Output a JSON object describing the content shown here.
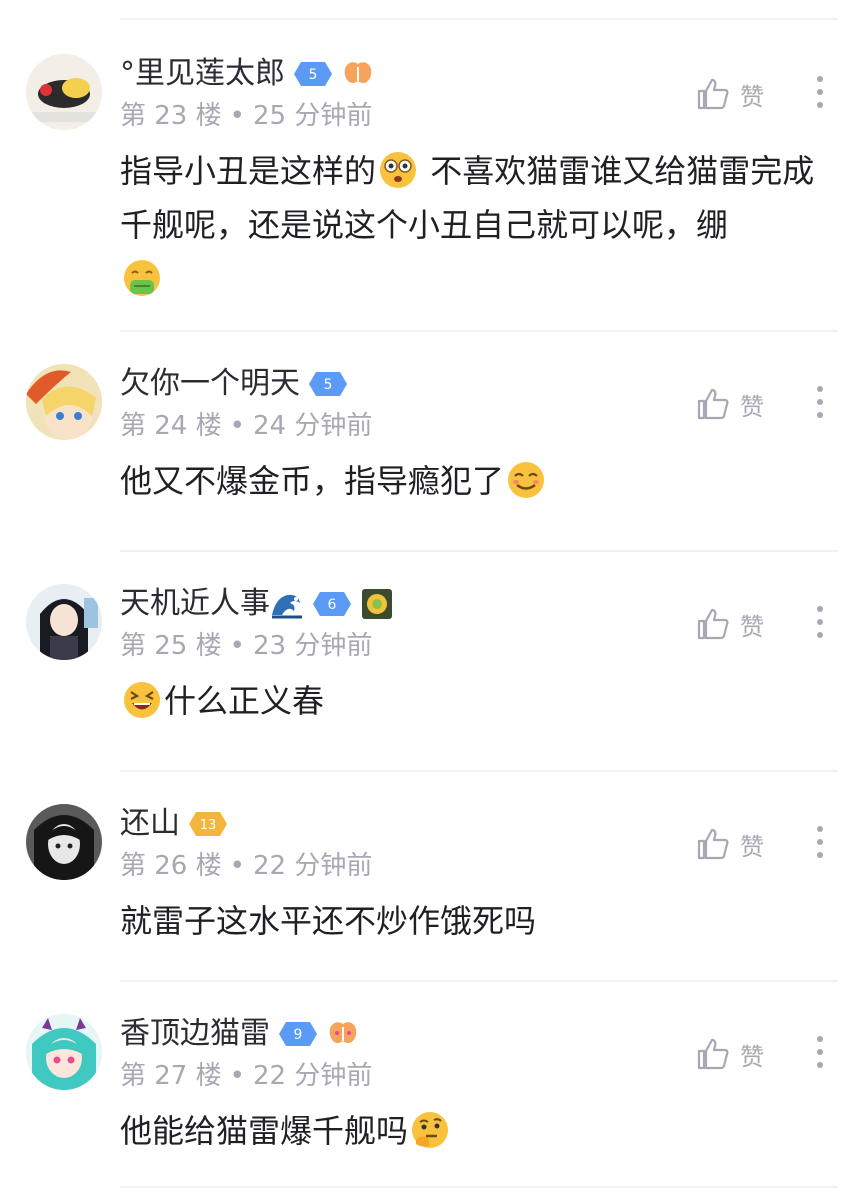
{
  "ui": {
    "like_label": "赞"
  },
  "comments": [
    {
      "username": "°里见莲太郎",
      "level": "5",
      "floor": "第 23 楼",
      "time": "25 分钟前",
      "text_1": "指导小丑是这样的",
      "text_2": " 不喜欢猫雷谁又给猫雷完成千舰呢，还是说这个小丑自己就可以呢，绷"
    },
    {
      "username": "欠你一个明天",
      "level": "5",
      "floor": "第 24 楼",
      "time": "24 分钟前",
      "text_1": "他又不爆金币，指导瘾犯了"
    },
    {
      "username": "天机近人事",
      "level": "6",
      "floor": "第 25 楼",
      "time": "23 分钟前",
      "text_1": "什么正义春"
    },
    {
      "username": "还山",
      "level": "13",
      "floor": "第 26 楼",
      "time": "22 分钟前",
      "text_1": "就雷子这水平还不炒作饿死吗"
    },
    {
      "username": "香顶边猫雷",
      "level": "9",
      "floor": "第 27 楼",
      "time": "22 分钟前",
      "text_1": "他能给猫雷爆千舰吗"
    }
  ],
  "colors": {
    "badge_blue": "#5b9bf5",
    "badge_gold": "#f3b53d",
    "meta_gray": "#a8a8b3",
    "divider": "#f1f1f4"
  }
}
